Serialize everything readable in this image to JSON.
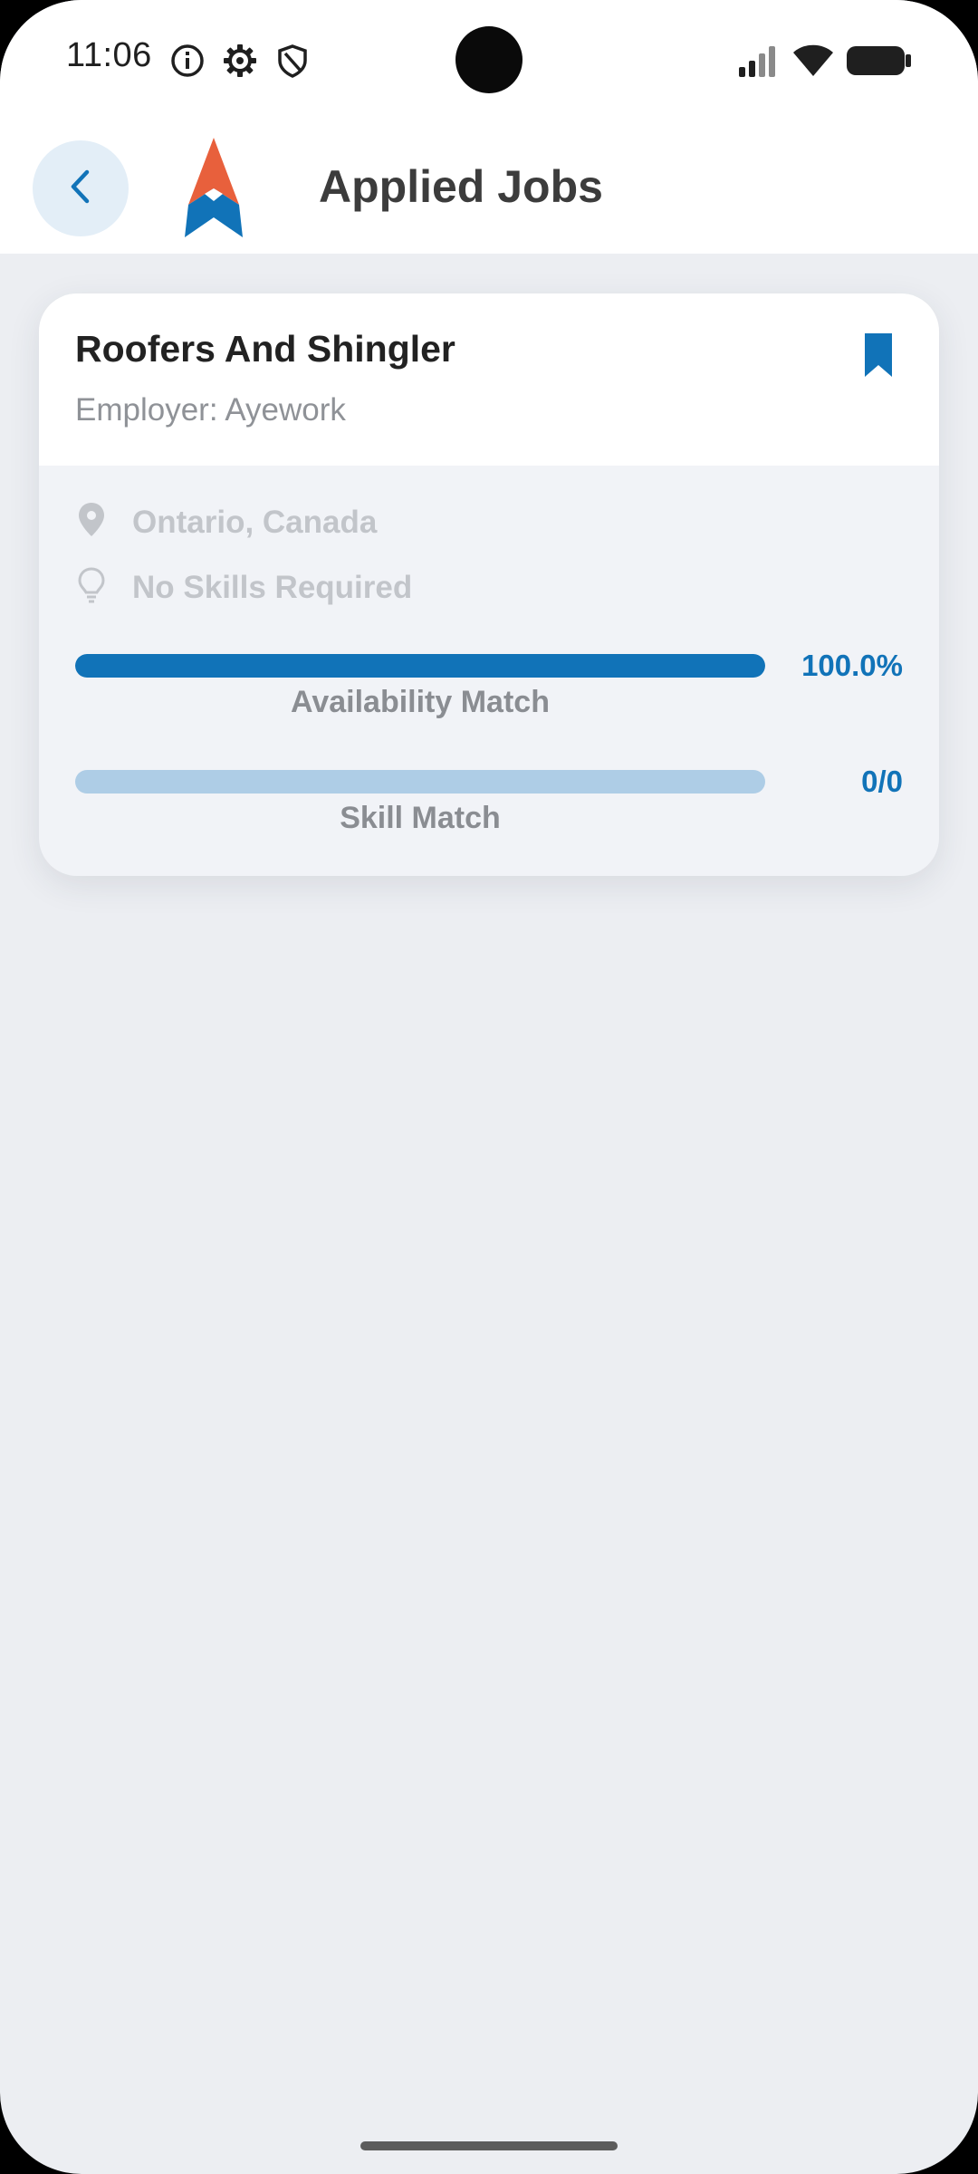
{
  "status_bar": {
    "time": "11:06",
    "left_icons": [
      "info-icon",
      "gear-icon",
      "shield-icon"
    ],
    "right_icons": [
      "signal-icon",
      "wifi-icon",
      "battery-icon"
    ]
  },
  "app_bar": {
    "title": "Applied Jobs",
    "back_icon": "chevron-left-icon",
    "logo": "app-logo"
  },
  "jobs": [
    {
      "title": "Roofers And Shingler",
      "employer": "Employer: Ayework",
      "bookmarked": true,
      "location": "Ontario, Canada",
      "skills": "No Skills Required",
      "availability": {
        "label": "Availability Match",
        "value_text": "100.0%",
        "fraction": 1.0
      },
      "skill_match": {
        "label": "Skill Match",
        "value_text": "0/0",
        "fraction": 0
      }
    }
  ],
  "colors": {
    "accent": "#1173B8",
    "accent_light": "#AECDE6",
    "logo_orange": "#E8603C",
    "background": "#ECEEF2"
  }
}
